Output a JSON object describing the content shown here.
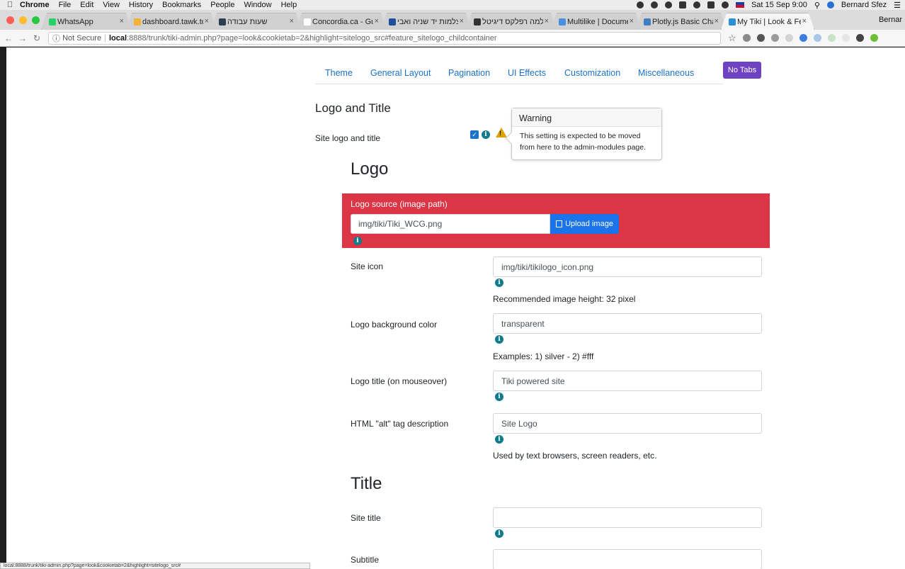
{
  "menubar": {
    "app": "Chrome",
    "items": [
      "File",
      "Edit",
      "View",
      "History",
      "Bookmarks",
      "People",
      "Window",
      "Help"
    ],
    "datetime": "Sat 15 Sep 9:00",
    "user": "Bernard Sfez"
  },
  "tabs": [
    {
      "label": "WhatsApp",
      "favicon_color": "#25d366"
    },
    {
      "label": "dashboard.tawk.to",
      "favicon_color": "#f2b233"
    },
    {
      "label": "שעות עבודה",
      "favicon_color": "#2c3e50"
    },
    {
      "label": "Concordia.ca - Gue",
      "favicon_color": "#ffffff"
    },
    {
      "label": "מצלמות יד שניה ואבי",
      "favicon_color": "#1f4e9c"
    },
    {
      "label": "מצלמה רפלקס דיגיטל",
      "favicon_color": "#333333"
    },
    {
      "label": "Multilike | Documen",
      "favicon_color": "#4a90e2"
    },
    {
      "label": "Plotly.js Basic Chart",
      "favicon_color": "#3d7fc0"
    },
    {
      "label": "My Tiki | Look & Fee",
      "favicon_color": "#2a8fd7",
      "active": true
    }
  ],
  "tab_user": "Bernar",
  "address": {
    "security": "Not Secure",
    "host": "local",
    "path": ":8888/trunk/tiki-admin.php?page=look&cookietab=2&highlight=sitelogo_src#feature_sitelogo_childcontainer"
  },
  "nav": {
    "links": [
      "Theme",
      "General Layout",
      "Pagination",
      "UI Effects",
      "Customization",
      "Miscellaneous"
    ],
    "no_tabs": "No Tabs"
  },
  "section_title": "Logo and Title",
  "site_logo_label": "Site logo and title",
  "site_logo_checked": true,
  "popover": {
    "title": "Warning",
    "body": "This setting is expected to be moved from here to the admin-modules page."
  },
  "logo_heading": "Logo",
  "logo_source": {
    "label": "Logo source (image path)",
    "value": "img/tiki/Tiki_WCG.png",
    "button": "Upload image"
  },
  "rows": [
    {
      "label": "Site icon",
      "value": "img/tiki/tikilogo_icon.png",
      "help": "Recommended image height: 32 pixel"
    },
    {
      "label": "Logo background color",
      "value": "transparent",
      "help": "Examples: 1) silver - 2) #fff"
    },
    {
      "label": "Logo title (on mouseover)",
      "value": "Tiki powered site",
      "help": ""
    },
    {
      "label": "HTML \"alt\" tag description",
      "value": "Site Logo",
      "help": "Used by text browsers, screen readers, etc."
    }
  ],
  "title_heading": "Title",
  "title_rows": [
    {
      "label": "Site title",
      "value": ""
    },
    {
      "label": "Subtitle",
      "value": ""
    }
  ],
  "status_url": "local:8888/trunk/tiki-admin.php?page=look&cookietab=2&highlight=sitelogo_src#"
}
